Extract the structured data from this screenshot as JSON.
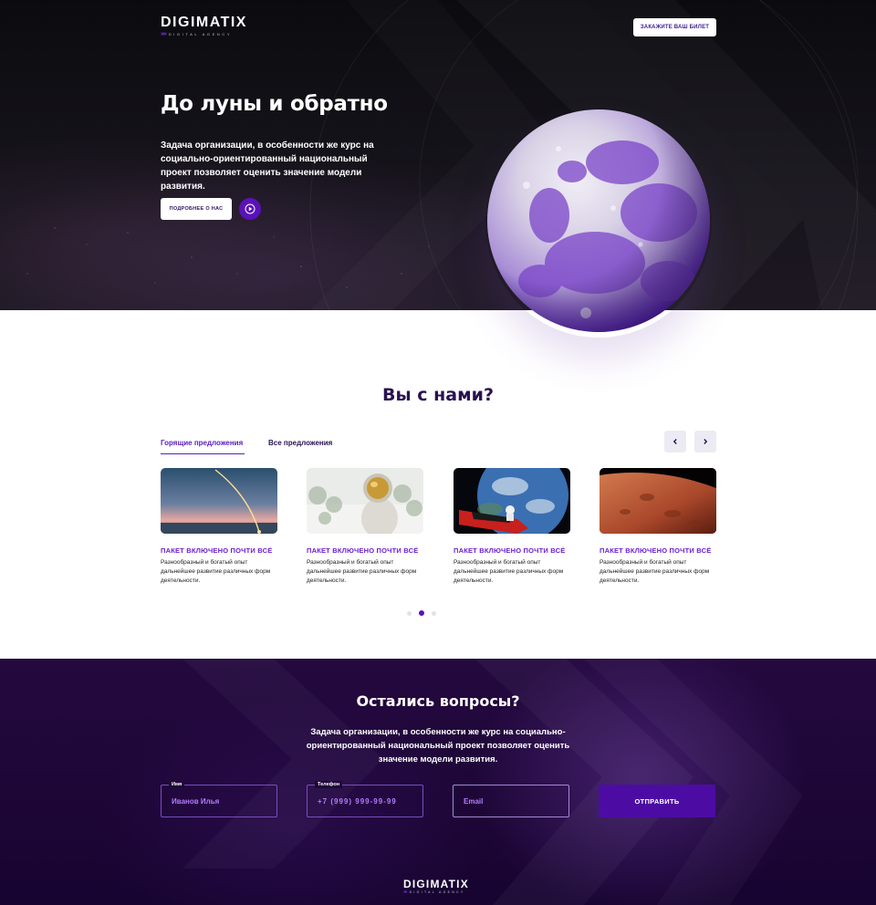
{
  "header": {
    "logo_name": "DIGIMATIX",
    "logo_arrows": "»»",
    "logo_sub": "DIGITAL AGENCY",
    "ticket_button": "ЗАКАЖИТЕ ВАШ БИЛЕТ"
  },
  "hero": {
    "title": "До луны и обратно",
    "description": "Задача организации, в особенности же курс на социально-ориентированный национальный проект позволяет оценить значение модели развития.",
    "more_button": "ПОДРОБНЕЕ О НАС",
    "play_icon": "play-circle-icon"
  },
  "offers": {
    "title": "Вы с нами?",
    "tabs": [
      {
        "label": "Горящие предложения",
        "active": true
      },
      {
        "label": "Все предложения",
        "active": false
      }
    ],
    "prev_icon": "chevron-left-icon",
    "next_icon": "chevron-right-icon",
    "cards": [
      {
        "image": "rocket-launch",
        "title": "ПАКЕТ ВКЛЮЧЕНО ПОЧТИ ВСЁ",
        "text": "Разнообразный и богатый опыт дальнейшее развитие различных форм деятельности."
      },
      {
        "image": "astronaut",
        "title": "ПАКЕТ ВКЛЮЧЕНО ПОЧТИ ВСЁ",
        "text": "Разнообразный и богатый опыт дальнейшее развитие различных форм деятельности."
      },
      {
        "image": "car-in-space-earth",
        "title": "ПАКЕТ ВКЛЮЧЕНО ПОЧТИ ВСЁ",
        "text": "Разнообразный и богатый опыт дальнейшее развитие различных форм деятельности."
      },
      {
        "image": "mars-surface",
        "title": "ПАКЕТ ВКЛЮЧЕНО ПОЧТИ ВСЁ",
        "text": "Разнообразный и богатый опыт дальнейшее развитие различных форм деятельности."
      }
    ],
    "pager": {
      "pages": 3,
      "active_index": 1
    }
  },
  "contact": {
    "title": "Остались вопросы?",
    "description": "Задача организации, в особенности же курс на социально-ориентированный национальный проект позволяет оценить значение модели развития.",
    "name_label": "Имя",
    "name_value": "Иванов Илья",
    "phone_label": "Телефон",
    "phone_value": "+7 (999) 999-99-99",
    "email_placeholder": "Email",
    "submit": "ОТПРАВИТЬ"
  },
  "footer": {
    "logo_name": "DIGIMATIX",
    "logo_arrows": "»»",
    "logo_sub": "DIGITAL AGENCY"
  },
  "colors": {
    "accent": "#5a12b8",
    "heading_dark": "#2a1150",
    "card_title": "#6a1fd0",
    "contact_bg": "#1d0636"
  }
}
